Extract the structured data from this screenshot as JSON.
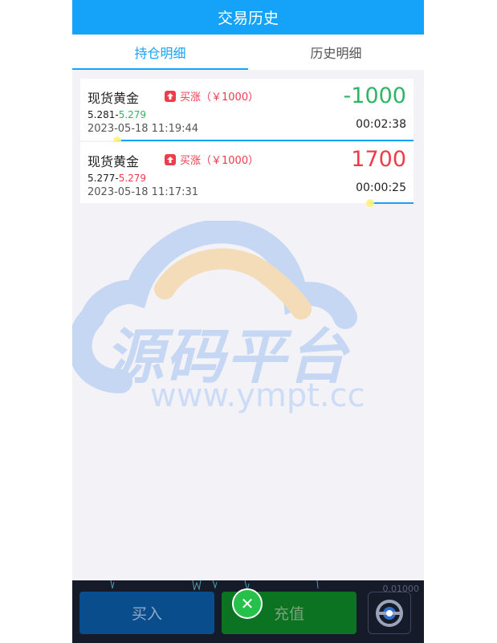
{
  "header": {
    "title": "交易历史"
  },
  "tabs": [
    {
      "label": "持仓明细",
      "active": true
    },
    {
      "label": "历史明细",
      "active": false
    }
  ],
  "positions": [
    {
      "name": "现货黄金",
      "direction": "买涨（￥1000）",
      "open_price": "5.281",
      "range_sep": "-",
      "current_price": "5.279",
      "time": "2023-05-18 11:19:44",
      "pnl": "-1000",
      "countdown": "00:02:38",
      "progress": 0.11
    },
    {
      "name": "现货黄金",
      "direction": "买涨（￥1000）",
      "open_price": "5.277",
      "range_sep": "-",
      "current_price": "5.279",
      "time": "2023-05-18 11:17:31",
      "pnl": "1700",
      "countdown": "00:00:25",
      "progress": 0.87
    }
  ],
  "watermark": {
    "text": "源码平台",
    "url": "www.ympt.cc"
  },
  "bottom": {
    "scale_label": "0.01000",
    "buy_label": "买入",
    "recharge_label": "充值",
    "close_glyph": "✕"
  },
  "colors": {
    "accent": "#14a3f8",
    "up": "#ef3c4a",
    "down": "#2fb565"
  }
}
